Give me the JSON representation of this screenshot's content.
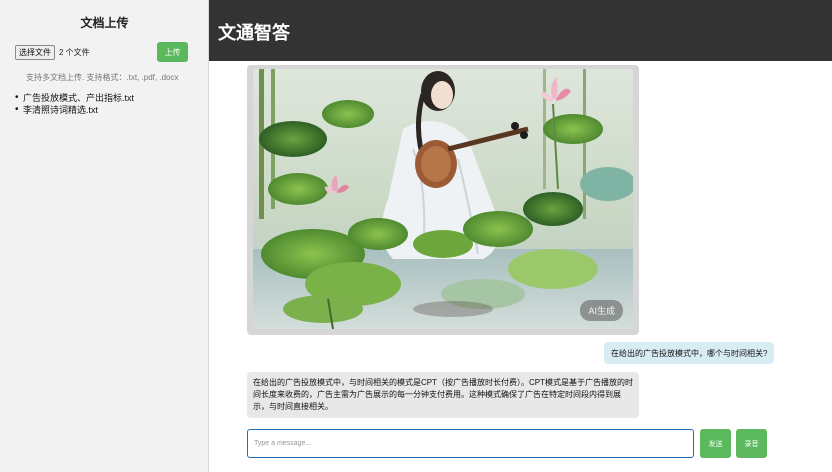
{
  "sidebar": {
    "title": "文档上传",
    "choose_file_label": "选择文件",
    "file_count": "2 个文件",
    "upload_label": "上传",
    "hint": "支持多文档上传. 支持格式：.txt, .pdf, .docx",
    "files": [
      "广告投放模式、产出指标.txt",
      "李清照诗词精选.txt"
    ]
  },
  "header": {
    "title": "文通智答"
  },
  "chat": {
    "image_badge": "AI生成",
    "image_icon": "ai-painting-image",
    "user_message": "在给出的广告投放模式中，哪个与时间相关?",
    "bot_message": "在给出的广告投放模式中，与时间相关的模式是CPT（按广告播放时长付费）。CPT模式是基于广告播放的时间长度来收费的，广告主需为广告展示的每一分钟支付费用。这种模式确保了广告在特定时间段内得到展示，与时间直接相关。",
    "input_placeholder": "Type a message...",
    "send_label": "发送",
    "voice_label": "录音"
  },
  "colors": {
    "header_bg": "#333333",
    "button_green": "#5cb85c",
    "user_bubble": "#d8ecf3",
    "bot_bubble": "#e8e8e8"
  }
}
